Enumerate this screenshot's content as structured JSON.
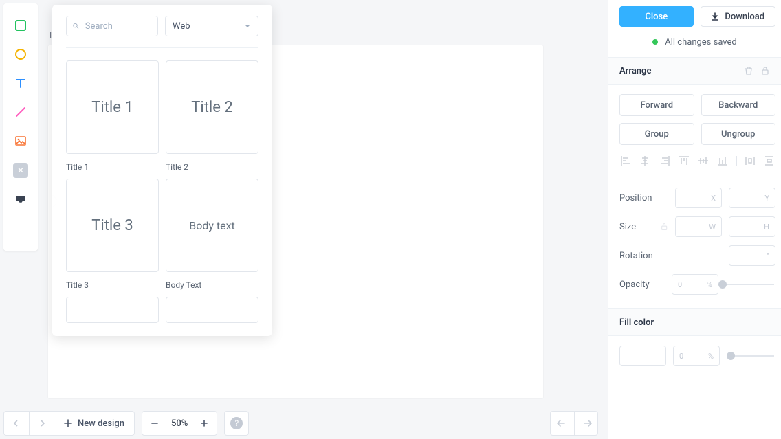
{
  "canvas": {
    "label": "I"
  },
  "popover": {
    "search": {
      "placeholder": "Search",
      "value": ""
    },
    "category": {
      "selected": "Web"
    },
    "items": [
      {
        "preview": "Title 1",
        "label": "Title 1"
      },
      {
        "preview": "Title 2",
        "label": "Title 2"
      },
      {
        "preview": "Title 3",
        "label": "Title 3"
      },
      {
        "preview": "Body text",
        "label": "Body Text"
      }
    ]
  },
  "bottom": {
    "new_design": "New design",
    "zoom": "50%"
  },
  "right": {
    "close": "Close",
    "download": "Download",
    "save_status": "All changes saved",
    "arrange": {
      "title": "Arrange",
      "forward": "Forward",
      "backward": "Backward",
      "group": "Group",
      "ungroup": "Ungroup"
    },
    "position": {
      "label": "Position",
      "x": "X",
      "y": "Y"
    },
    "size": {
      "label": "Size",
      "w": "W",
      "h": "H"
    },
    "rotation": {
      "label": "Rotation",
      "unit": "°"
    },
    "opacity": {
      "label": "Opacity",
      "value": "0",
      "unit": "%"
    },
    "fill": {
      "title": "Fill color",
      "value": "0",
      "unit": "%"
    }
  }
}
